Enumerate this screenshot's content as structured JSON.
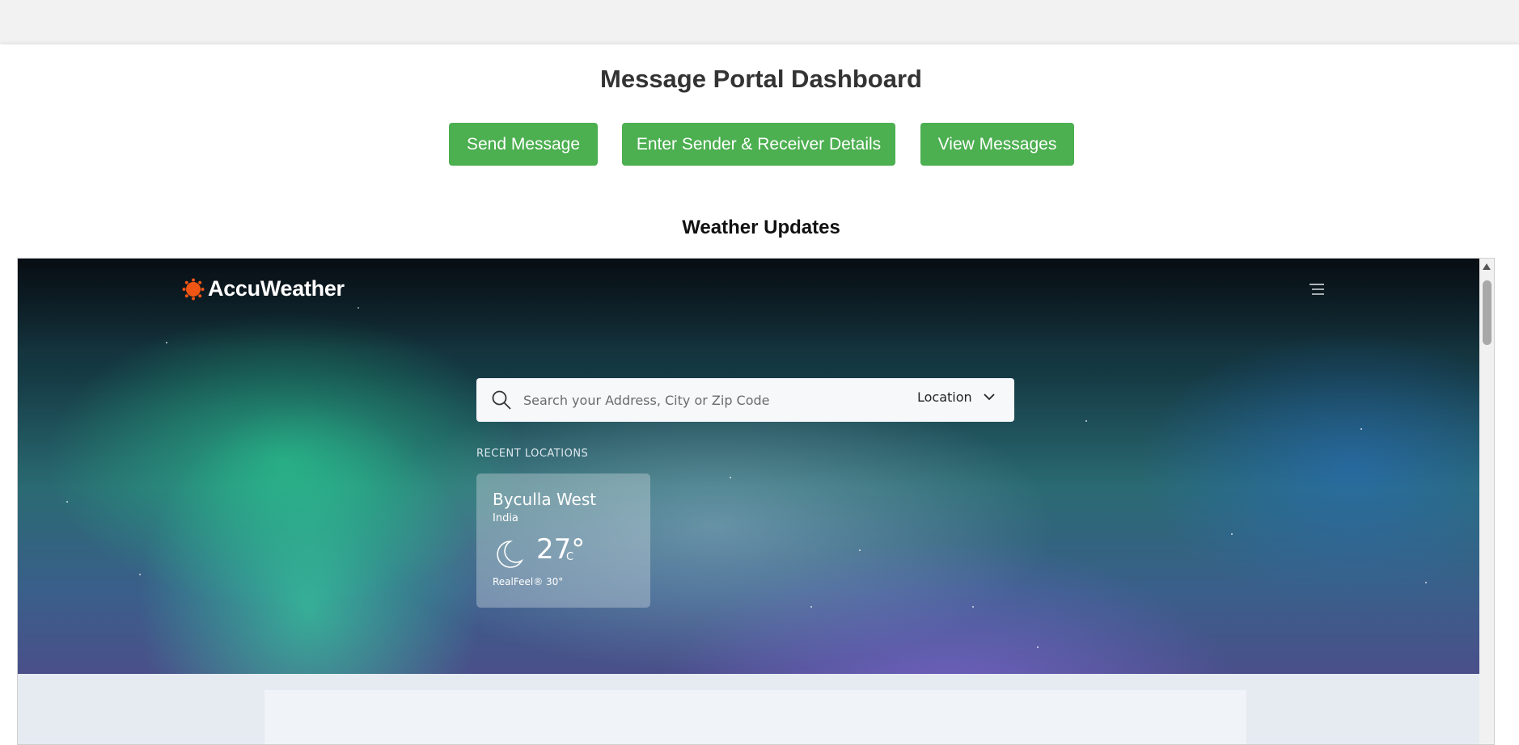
{
  "dashboard": {
    "title": "Message Portal Dashboard",
    "buttons": {
      "send": "Send Message",
      "details": "Enter Sender & Receiver Details",
      "view": "View Messages"
    },
    "weather_heading": "Weather Updates",
    "accent_color": "#4caf50"
  },
  "weather_widget": {
    "brand": "AccuWeather",
    "brand_color": "#f05514",
    "menu_icon": "hamburger-menu-icon",
    "search": {
      "placeholder": "Search your Address, City or Zip Code",
      "icon": "search-icon",
      "location_label": "Location"
    },
    "recent_locations_label": "RECENT LOCATIONS",
    "recent": [
      {
        "city": "Byculla West",
        "country": "India",
        "icon": "moon-icon",
        "temp": "27°",
        "unit": "C",
        "realfeel": "RealFeel® 30°"
      }
    ]
  }
}
